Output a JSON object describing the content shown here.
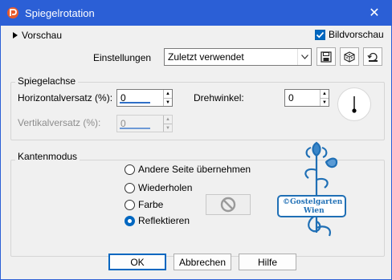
{
  "window": {
    "title": "Spiegelrotation",
    "close_glyph": "✕",
    "title_bar_color": "#2b5fd6",
    "app_icon": "psp-icon"
  },
  "top": {
    "preview_toggle_label": "Vorschau",
    "preview_toggle_icon": "triangle-right-icon",
    "image_preview_label": "Bildvorschau",
    "image_preview_checked": true,
    "settings_label": "Einstellungen",
    "settings_value": "Zuletzt verwendet",
    "icons": [
      "save-icon",
      "dice-randomize-icon",
      "reset-icon"
    ]
  },
  "mirror_axis": {
    "group_label": "Spiegelachse",
    "horizontal_offset_label": "Horizontalversatz (%):",
    "horizontal_offset_value": "0",
    "rotation_angle_label": "Drehwinkel:",
    "rotation_angle_value": "0",
    "vertical_offset_label": "Vertikalversatz (%):",
    "vertical_offset_value": "0",
    "vertical_offset_enabled": false,
    "dial_angle_deg": 0
  },
  "edge_mode": {
    "group_label": "Kantenmodus",
    "options": [
      {
        "label": "Andere Seite übernehmen",
        "selected": false
      },
      {
        "label": "Wiederholen",
        "selected": false
      },
      {
        "label": "Farbe",
        "selected": false
      },
      {
        "label": "Reflektieren",
        "selected": true
      }
    ],
    "color_swatch_icon": "no-color-icon"
  },
  "watermark": {
    "line1": "©Gostelgarten",
    "line2": "Wien",
    "color": "#1f6fb5"
  },
  "buttons": {
    "ok": "OK",
    "cancel": "Abbrechen",
    "help": "Hilfe"
  },
  "colors": {
    "accent": "#0067c0",
    "dialog_bg": "#f0f0f0"
  }
}
